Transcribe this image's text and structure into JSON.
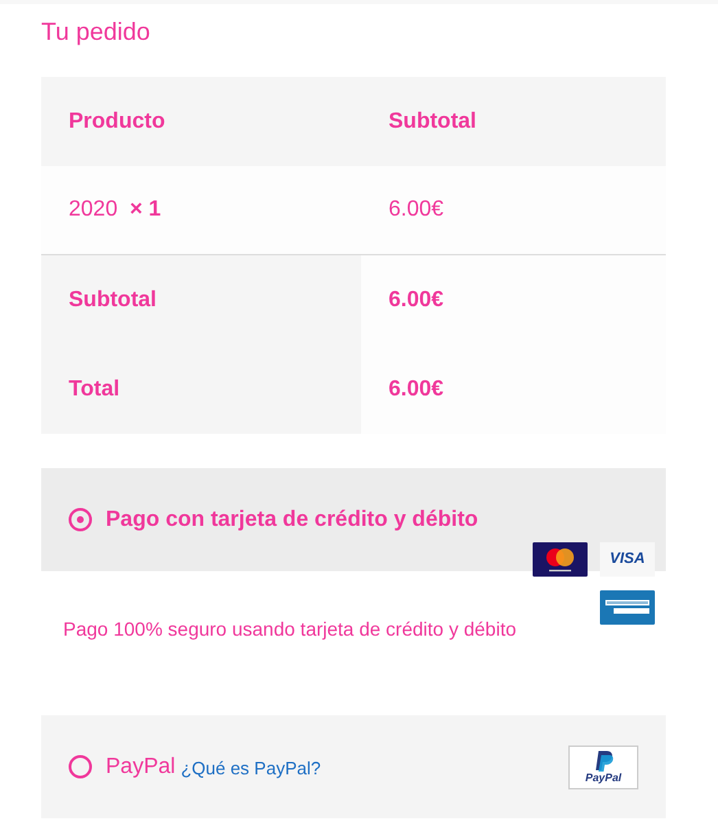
{
  "title": "Tu pedido",
  "table": {
    "columns": [
      "Producto",
      "Subtotal"
    ],
    "items": [
      {
        "product": "2020",
        "quantity": "× 1",
        "subtotal": "6.00€"
      }
    ],
    "totals": [
      {
        "label": "Subtotal",
        "value": "6.00€"
      },
      {
        "label": "Total",
        "value": "6.00€"
      }
    ]
  },
  "payment_methods": [
    {
      "kind": "card",
      "label": "Pago con tarjeta de crédito y débito",
      "selected": true,
      "logos": [
        {
          "kind": "mastercard"
        },
        {
          "kind": "visa",
          "text": "VISA"
        },
        {
          "kind": "amex"
        }
      ],
      "description": "Pago 100% seguro usando tarjeta de crédito y débito"
    },
    {
      "kind": "paypal",
      "label": "PayPal",
      "link": "¿Qué es PayPal?",
      "selected": false,
      "logos": [
        {
          "kind": "paypal",
          "text": "PayPal"
        }
      ]
    }
  ]
}
